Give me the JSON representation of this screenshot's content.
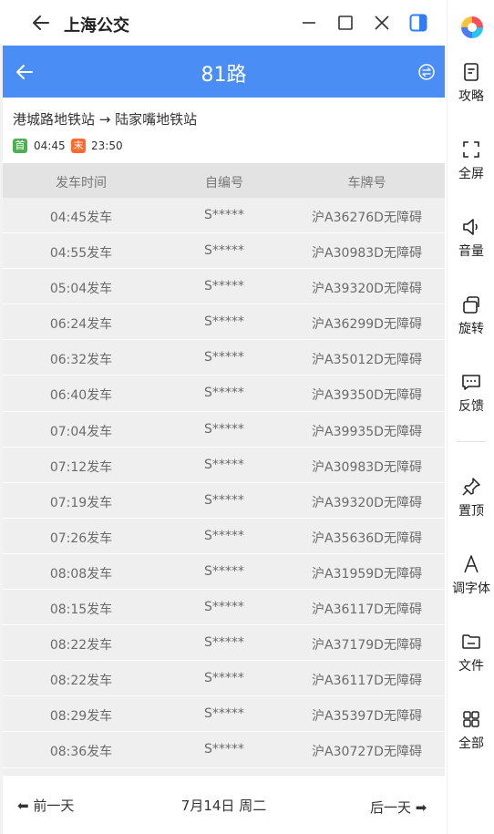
{
  "window": {
    "title": "上海公交"
  },
  "app": {
    "route_number": "81路",
    "route_name": "港城路地铁站 → 陆家嘴地铁站",
    "first_badge": "首",
    "first_time": "04:45",
    "last_badge": "末",
    "last_time": "23:50",
    "colors": {
      "header": "#4a8df4",
      "first_badge": "#4caf50",
      "last_badge": "#ff6a2c"
    }
  },
  "table": {
    "headers": [
      "发车时间",
      "自编号",
      "车牌号"
    ],
    "rows": [
      {
        "time": "04:45发车",
        "id": "S*****",
        "plate": "沪A36276D无障碍"
      },
      {
        "time": "04:55发车",
        "id": "S*****",
        "plate": "沪A30983D无障碍"
      },
      {
        "time": "05:04发车",
        "id": "S*****",
        "plate": "沪A39320D无障碍"
      },
      {
        "time": "06:24发车",
        "id": "S*****",
        "plate": "沪A36299D无障碍"
      },
      {
        "time": "06:32发车",
        "id": "S*****",
        "plate": "沪A35012D无障碍"
      },
      {
        "time": "06:40发车",
        "id": "S*****",
        "plate": "沪A39350D无障碍"
      },
      {
        "time": "07:04发车",
        "id": "S*****",
        "plate": "沪A39935D无障碍"
      },
      {
        "time": "07:12发车",
        "id": "S*****",
        "plate": "沪A30983D无障碍"
      },
      {
        "time": "07:19发车",
        "id": "S*****",
        "plate": "沪A39320D无障碍"
      },
      {
        "time": "07:26发车",
        "id": "S*****",
        "plate": "沪A35636D无障碍"
      },
      {
        "time": "08:08发车",
        "id": "S*****",
        "plate": "沪A31959D无障碍"
      },
      {
        "time": "08:15发车",
        "id": "S*****",
        "plate": "沪A36117D无障碍"
      },
      {
        "time": "08:22发车",
        "id": "S*****",
        "plate": "沪A37179D无障碍"
      },
      {
        "time": "08:22发车",
        "id": "S*****",
        "plate": "沪A36117D无障碍"
      },
      {
        "time": "08:29发车",
        "id": "S*****",
        "plate": "沪A35397D无障碍"
      },
      {
        "time": "08:36发车",
        "id": "S*****",
        "plate": "沪A30727D无障碍"
      },
      {
        "time": "",
        "id": "",
        "plate": ""
      }
    ]
  },
  "footer": {
    "prev": "⬅ 前一天",
    "date": "7月14日 周二",
    "next": "后一天 ➡"
  },
  "sidebar": {
    "items": [
      {
        "label": "攻略",
        "icon": "guide-icon"
      },
      {
        "label": "全屏",
        "icon": "fullscreen-icon"
      },
      {
        "label": "音量",
        "icon": "volume-icon"
      },
      {
        "label": "旋转",
        "icon": "rotate-icon"
      },
      {
        "label": "反馈",
        "icon": "feedback-icon"
      },
      {
        "label": "置顶",
        "icon": "pin-icon"
      },
      {
        "label": "调字体",
        "icon": "font-icon"
      },
      {
        "label": "文件",
        "icon": "folder-icon"
      },
      {
        "label": "全部",
        "icon": "grid-icon"
      }
    ]
  }
}
